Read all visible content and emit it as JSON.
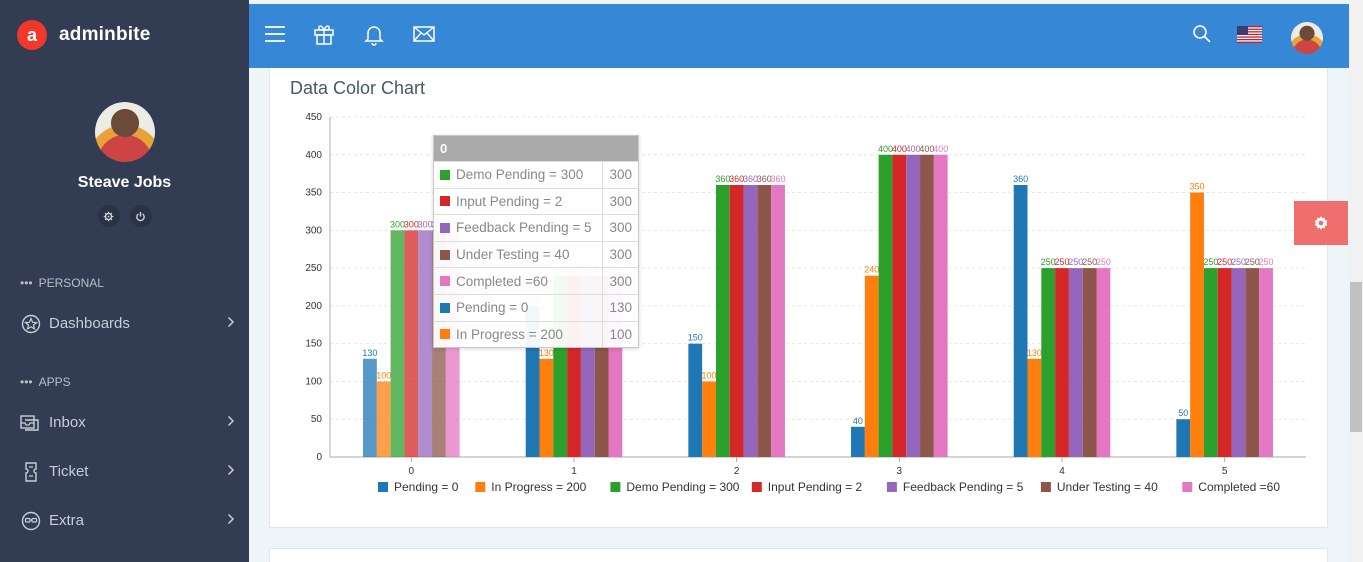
{
  "brand": {
    "name": "adminbite",
    "logo_letter": "a"
  },
  "profile": {
    "name": "Steave Jobs"
  },
  "sidebar": {
    "sections": [
      {
        "label": "PERSONAL",
        "items": [
          {
            "label": "Dashboards",
            "icon": "dashboard-icon"
          }
        ]
      },
      {
        "label": "APPS",
        "items": [
          {
            "label": "Inbox",
            "icon": "inbox-icon"
          },
          {
            "label": "Ticket",
            "icon": "ticket-icon"
          },
          {
            "label": "Extra",
            "icon": "extra-icon"
          }
        ]
      }
    ]
  },
  "header": {
    "icons": [
      "menu-icon",
      "gift-icon",
      "bell-icon",
      "mail-icon",
      "search-icon",
      "flag-us-icon",
      "user-avatar"
    ]
  },
  "card": {
    "title": "Data Color Chart"
  },
  "tooltip": {
    "header": "0",
    "rows": [
      {
        "label": "Demo Pending = 300",
        "value": "300",
        "color": "#2ca02c"
      },
      {
        "label": "Input Pending = 2",
        "value": "300",
        "color": "#d62728"
      },
      {
        "label": "Feedback Pending = 5",
        "value": "300",
        "color": "#9467bd"
      },
      {
        "label": "Under Testing = 40",
        "value": "300",
        "color": "#8c564b"
      },
      {
        "label": "Completed =60",
        "value": "300",
        "color": "#e377c2"
      },
      {
        "label": "Pending = 0",
        "value": "130",
        "color": "#1f77b4"
      },
      {
        "label": "In Progress = 200",
        "value": "100",
        "color": "#ff7f0e"
      }
    ]
  },
  "chart_data": {
    "type": "bar",
    "title": "Data Color Chart",
    "categories": [
      "0",
      "1",
      "2",
      "3",
      "4",
      "5"
    ],
    "ylim": [
      0,
      450
    ],
    "yticks": [
      0,
      50,
      100,
      150,
      200,
      250,
      300,
      350,
      400,
      450
    ],
    "grid": true,
    "legend_position": "bottom",
    "series": [
      {
        "name": "Pending = 0",
        "color": "#1f77b4",
        "values": [
          130,
          200,
          150,
          40,
          360,
          50
        ]
      },
      {
        "name": "In Progress = 200",
        "color": "#ff7f0e",
        "values": [
          100,
          130,
          100,
          240,
          130,
          350
        ]
      },
      {
        "name": "Demo Pending = 300",
        "color": "#2ca02c",
        "values": [
          300,
          240,
          360,
          400,
          250,
          250
        ]
      },
      {
        "name": "Input Pending = 2",
        "color": "#d62728",
        "values": [
          300,
          240,
          360,
          400,
          250,
          250
        ]
      },
      {
        "name": "Feedback Pending = 5",
        "color": "#9467bd",
        "values": [
          300,
          240,
          360,
          400,
          250,
          250
        ]
      },
      {
        "name": "Under Testing = 40",
        "color": "#8c564b",
        "values": [
          300,
          240,
          360,
          400,
          250,
          250
        ]
      },
      {
        "name": "Completed =60",
        "color": "#e377c2",
        "values": [
          300,
          240,
          360,
          400,
          250,
          250
        ]
      }
    ]
  }
}
